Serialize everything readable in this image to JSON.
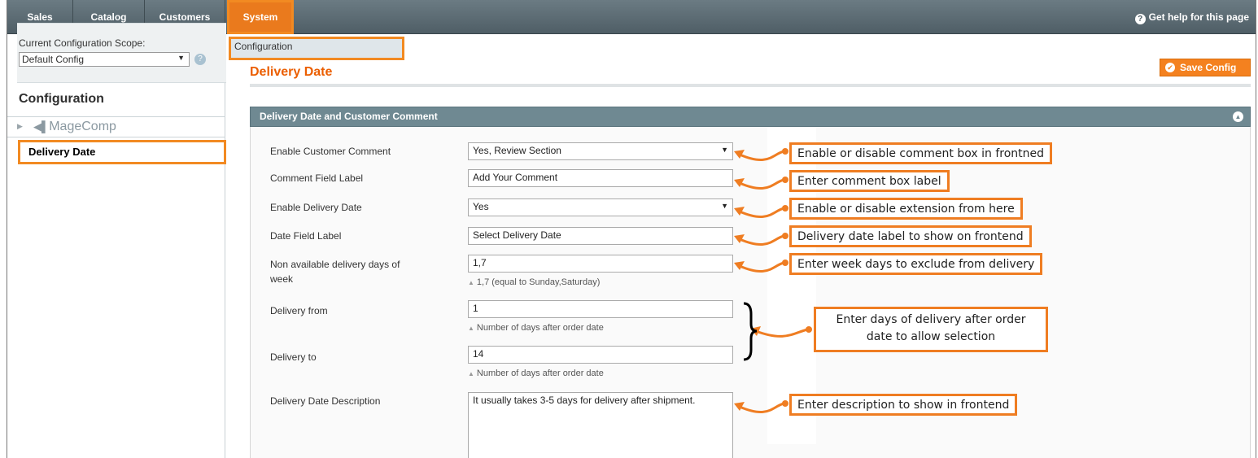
{
  "nav": {
    "items": [
      "Sales",
      "Catalog",
      "Customers",
      "System"
    ],
    "help_label": "Get help for this page",
    "dropdown_item": "Configuration"
  },
  "sidebar": {
    "scope_label": "Current Configuration Scope:",
    "scope_value": "Default Config",
    "config_title": "Configuration",
    "group_label": "MageComp",
    "active_item": "Delivery Date"
  },
  "main": {
    "page_title": "Delivery Date",
    "save_label": "Save Config",
    "section_title": "Delivery Date and Customer Comment",
    "fields": {
      "enable_comment": {
        "label": "Enable Customer Comment",
        "value": "Yes, Review Section"
      },
      "comment_label": {
        "label": "Comment Field Label",
        "value": "Add Your Comment"
      },
      "enable_date": {
        "label": "Enable Delivery Date",
        "value": "Yes"
      },
      "date_label": {
        "label": "Date Field Label",
        "value": "Select Delivery Date"
      },
      "non_available": {
        "label_line1": "Non available delivery days of",
        "label_line2": "week",
        "value": "1,7",
        "note": "1,7 (equal to Sunday,Saturday)"
      },
      "delivery_from": {
        "label": "Delivery from",
        "value": "1",
        "note": "Number of days after order date"
      },
      "delivery_to": {
        "label": "Delivery to",
        "value": "14",
        "note": "Number of days after order date"
      },
      "description": {
        "label": "Delivery Date Description",
        "value": "It usually takes 3-5 days for delivery after shipment."
      }
    }
  },
  "callouts": {
    "comment": "Enable or disable comment box in frontned",
    "label": "Enter comment box label",
    "extension": "Enable or disable extension from here",
    "date_label": "Delivery date label to show on frontend",
    "week_days": "Enter week days to exclude from delivery",
    "days_line1": "Enter days of delivery after order",
    "days_line2": "date to allow selection",
    "description": "Enter description to show in frontend"
  },
  "colors": {
    "accent": "#f28a22",
    "title": "#eb5e00",
    "section_head": "#6f8992"
  }
}
